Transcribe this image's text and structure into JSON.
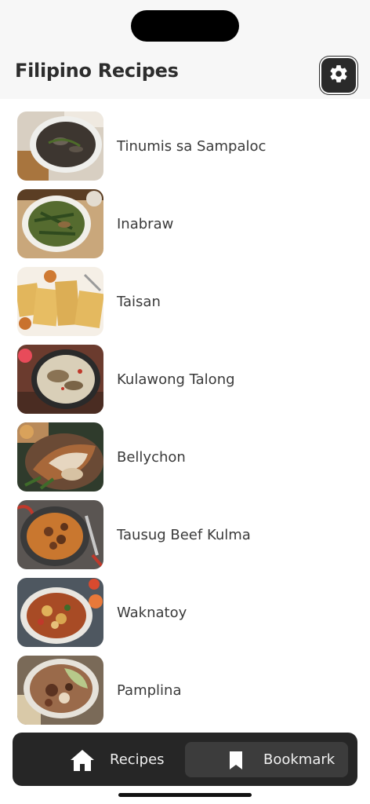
{
  "header": {
    "title": "Filipino Recipes",
    "settings_icon": "gear-icon"
  },
  "recipes": [
    {
      "name": "Tinumis sa Sampaloc"
    },
    {
      "name": "Inabraw"
    },
    {
      "name": "Taisan"
    },
    {
      "name": "Kulawong Talong"
    },
    {
      "name": "Bellychon"
    },
    {
      "name": "Tausug Beef Kulma"
    },
    {
      "name": "Waknatoy"
    },
    {
      "name": "Pamplina"
    }
  ],
  "nav": {
    "recipes_label": "Recipes",
    "recipes_icon": "home-icon",
    "bookmark_label": "Bookmark",
    "bookmark_icon": "bookmark-icon",
    "active": "bookmark"
  },
  "colors": {
    "nav_background": "#262626",
    "nav_active": "#3c3c3c",
    "header_background": "#f7f7f7"
  }
}
